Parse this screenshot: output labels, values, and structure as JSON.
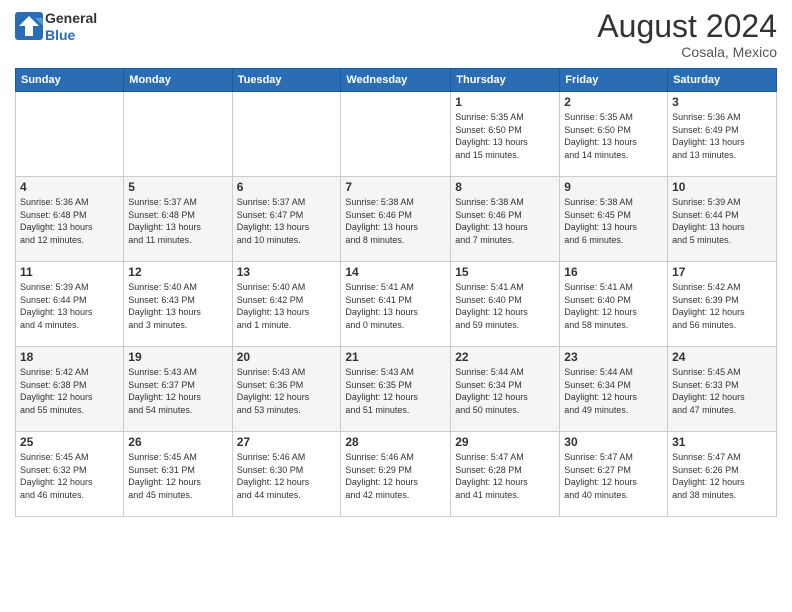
{
  "header": {
    "logo": {
      "line1": "General",
      "line2": "Blue"
    },
    "title": "August 2024",
    "subtitle": "Cosala, Mexico"
  },
  "calendar": {
    "days_of_week": [
      "Sunday",
      "Monday",
      "Tuesday",
      "Wednesday",
      "Thursday",
      "Friday",
      "Saturday"
    ],
    "weeks": [
      [
        {
          "day": "",
          "info": ""
        },
        {
          "day": "",
          "info": ""
        },
        {
          "day": "",
          "info": ""
        },
        {
          "day": "",
          "info": ""
        },
        {
          "day": "1",
          "info": "Sunrise: 5:35 AM\nSunset: 6:50 PM\nDaylight: 13 hours\nand 15 minutes."
        },
        {
          "day": "2",
          "info": "Sunrise: 5:35 AM\nSunset: 6:50 PM\nDaylight: 13 hours\nand 14 minutes."
        },
        {
          "day": "3",
          "info": "Sunrise: 5:36 AM\nSunset: 6:49 PM\nDaylight: 13 hours\nand 13 minutes."
        }
      ],
      [
        {
          "day": "4",
          "info": "Sunrise: 5:36 AM\nSunset: 6:48 PM\nDaylight: 13 hours\nand 12 minutes."
        },
        {
          "day": "5",
          "info": "Sunrise: 5:37 AM\nSunset: 6:48 PM\nDaylight: 13 hours\nand 11 minutes."
        },
        {
          "day": "6",
          "info": "Sunrise: 5:37 AM\nSunset: 6:47 PM\nDaylight: 13 hours\nand 10 minutes."
        },
        {
          "day": "7",
          "info": "Sunrise: 5:38 AM\nSunset: 6:46 PM\nDaylight: 13 hours\nand 8 minutes."
        },
        {
          "day": "8",
          "info": "Sunrise: 5:38 AM\nSunset: 6:46 PM\nDaylight: 13 hours\nand 7 minutes."
        },
        {
          "day": "9",
          "info": "Sunrise: 5:38 AM\nSunset: 6:45 PM\nDaylight: 13 hours\nand 6 minutes."
        },
        {
          "day": "10",
          "info": "Sunrise: 5:39 AM\nSunset: 6:44 PM\nDaylight: 13 hours\nand 5 minutes."
        }
      ],
      [
        {
          "day": "11",
          "info": "Sunrise: 5:39 AM\nSunset: 6:44 PM\nDaylight: 13 hours\nand 4 minutes."
        },
        {
          "day": "12",
          "info": "Sunrise: 5:40 AM\nSunset: 6:43 PM\nDaylight: 13 hours\nand 3 minutes."
        },
        {
          "day": "13",
          "info": "Sunrise: 5:40 AM\nSunset: 6:42 PM\nDaylight: 13 hours\nand 1 minute."
        },
        {
          "day": "14",
          "info": "Sunrise: 5:41 AM\nSunset: 6:41 PM\nDaylight: 13 hours\nand 0 minutes."
        },
        {
          "day": "15",
          "info": "Sunrise: 5:41 AM\nSunset: 6:40 PM\nDaylight: 12 hours\nand 59 minutes."
        },
        {
          "day": "16",
          "info": "Sunrise: 5:41 AM\nSunset: 6:40 PM\nDaylight: 12 hours\nand 58 minutes."
        },
        {
          "day": "17",
          "info": "Sunrise: 5:42 AM\nSunset: 6:39 PM\nDaylight: 12 hours\nand 56 minutes."
        }
      ],
      [
        {
          "day": "18",
          "info": "Sunrise: 5:42 AM\nSunset: 6:38 PM\nDaylight: 12 hours\nand 55 minutes."
        },
        {
          "day": "19",
          "info": "Sunrise: 5:43 AM\nSunset: 6:37 PM\nDaylight: 12 hours\nand 54 minutes."
        },
        {
          "day": "20",
          "info": "Sunrise: 5:43 AM\nSunset: 6:36 PM\nDaylight: 12 hours\nand 53 minutes."
        },
        {
          "day": "21",
          "info": "Sunrise: 5:43 AM\nSunset: 6:35 PM\nDaylight: 12 hours\nand 51 minutes."
        },
        {
          "day": "22",
          "info": "Sunrise: 5:44 AM\nSunset: 6:34 PM\nDaylight: 12 hours\nand 50 minutes."
        },
        {
          "day": "23",
          "info": "Sunrise: 5:44 AM\nSunset: 6:34 PM\nDaylight: 12 hours\nand 49 minutes."
        },
        {
          "day": "24",
          "info": "Sunrise: 5:45 AM\nSunset: 6:33 PM\nDaylight: 12 hours\nand 47 minutes."
        }
      ],
      [
        {
          "day": "25",
          "info": "Sunrise: 5:45 AM\nSunset: 6:32 PM\nDaylight: 12 hours\nand 46 minutes."
        },
        {
          "day": "26",
          "info": "Sunrise: 5:45 AM\nSunset: 6:31 PM\nDaylight: 12 hours\nand 45 minutes."
        },
        {
          "day": "27",
          "info": "Sunrise: 5:46 AM\nSunset: 6:30 PM\nDaylight: 12 hours\nand 44 minutes."
        },
        {
          "day": "28",
          "info": "Sunrise: 5:46 AM\nSunset: 6:29 PM\nDaylight: 12 hours\nand 42 minutes."
        },
        {
          "day": "29",
          "info": "Sunrise: 5:47 AM\nSunset: 6:28 PM\nDaylight: 12 hours\nand 41 minutes."
        },
        {
          "day": "30",
          "info": "Sunrise: 5:47 AM\nSunset: 6:27 PM\nDaylight: 12 hours\nand 40 minutes."
        },
        {
          "day": "31",
          "info": "Sunrise: 5:47 AM\nSunset: 6:26 PM\nDaylight: 12 hours\nand 38 minutes."
        }
      ]
    ]
  }
}
